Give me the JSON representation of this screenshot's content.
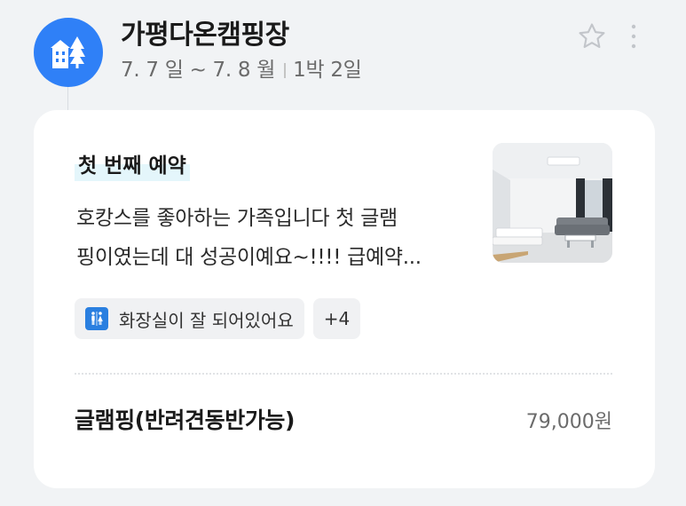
{
  "booking": {
    "place_name": "가평다온캠핑장",
    "check_in": "7. 7 일 ~ 7. 8 월",
    "duration": "1박 2일"
  },
  "icons": {
    "avatar": "building-tree-icon",
    "favorite": "star-outline-icon",
    "more": "vertical-dots-icon",
    "chip": "restroom-icon"
  },
  "review": {
    "tag": "첫 번째 예약",
    "text_line1": "호캉스를 좋아하는 가족입니다 첫 글램",
    "text_line2": "핑이였는데 대 성공이예요~!!!! 급예약...",
    "keyword": "화장실이 잘 되어있어요",
    "more_keywords": "+4"
  },
  "room": {
    "name": "글램핑(반려견동반가능)",
    "price": "79,000원"
  },
  "colors": {
    "accent": "#2f80f7",
    "tag_highlight": "#e4f6fb",
    "card_bg": "#ffffff",
    "page_bg": "#f1f3f5"
  }
}
